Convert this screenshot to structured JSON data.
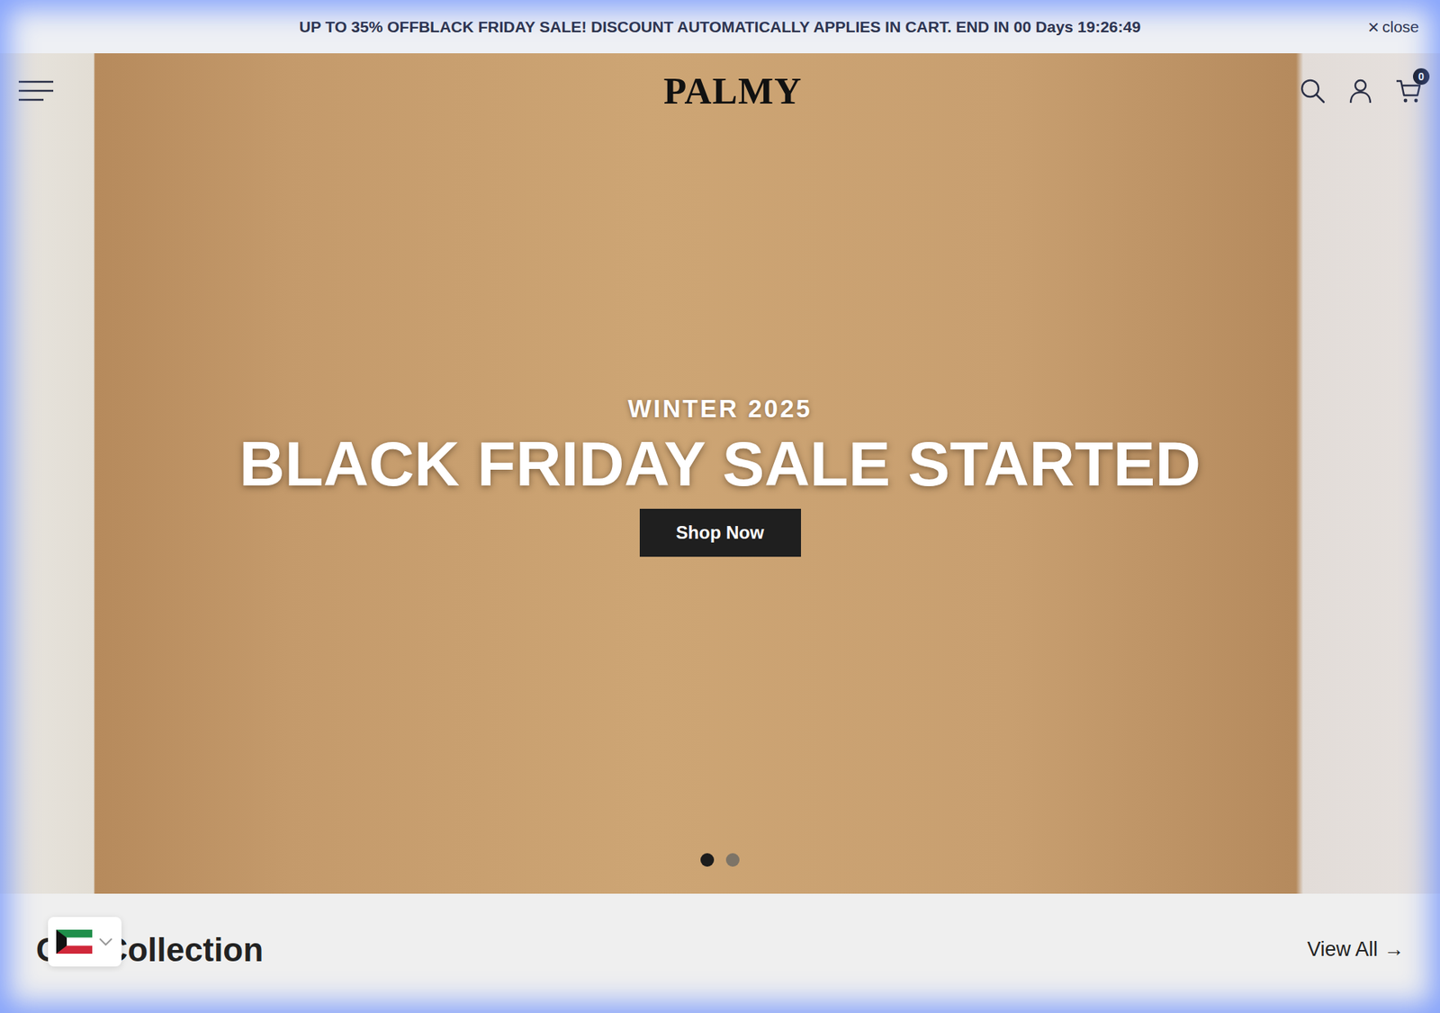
{
  "announcement": {
    "text": "UP TO 35% OFFBLACK FRIDAY SALE! DISCOUNT AUTOMATICALLY APPLIES IN CART. END IN 00 Days 19:26:49",
    "close_icon": "×",
    "close_label": "close"
  },
  "header": {
    "logo": "PALMY",
    "cart_count": "0"
  },
  "hero": {
    "eyebrow": "WINTER 2025",
    "title": "BLACK FRIDAY SALE STARTED",
    "button": "Shop Now",
    "slides": [
      {
        "selected": true
      },
      {
        "selected": false
      }
    ]
  },
  "collection": {
    "title": "Our Collection",
    "link": "View All",
    "link_icon": "→"
  },
  "country_selector": {
    "expanded": false
  }
}
